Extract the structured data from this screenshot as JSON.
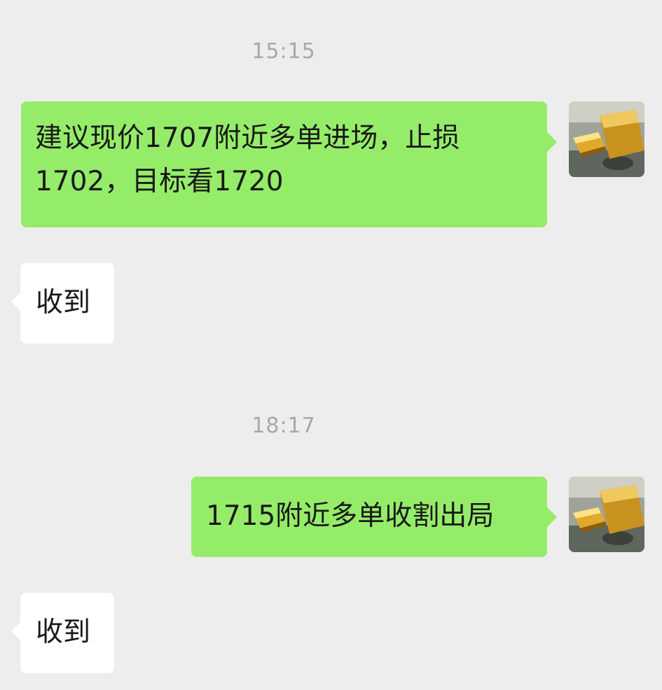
{
  "chat": {
    "messages": [
      {
        "type": "timestamp",
        "text": "15:15"
      },
      {
        "type": "outgoing",
        "line1": "建议现价1707附近多单进场，止损",
        "line2": "1702，目标看1720"
      },
      {
        "type": "incoming",
        "text": "收到"
      },
      {
        "type": "timestamp",
        "text": "18:17"
      },
      {
        "type": "outgoing",
        "text": "1715附近多单收割出局"
      },
      {
        "type": "incoming",
        "text": "收到"
      }
    ]
  },
  "avatar": {
    "icon": "gold-bar-avatar"
  },
  "colors": {
    "background": "#EDEDED",
    "outgoing_bubble": "#95EC69",
    "incoming_bubble": "#FFFFFF",
    "timestamp_text": "#A8A8A8",
    "message_text": "#191919"
  }
}
